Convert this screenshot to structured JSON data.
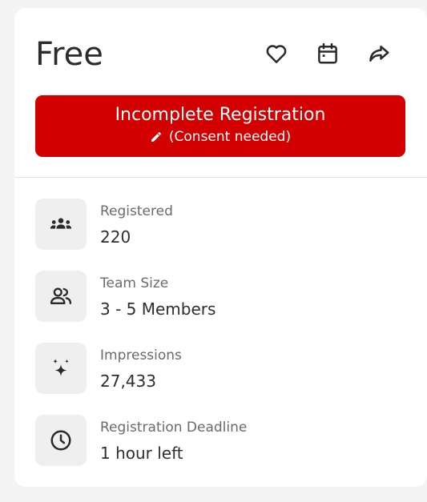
{
  "header": {
    "price": "Free",
    "icons": [
      "heart-icon",
      "calendar-icon",
      "share-icon"
    ]
  },
  "registration": {
    "title": "Incomplete Registration",
    "subtitle": "(Consent needed)",
    "icon": "pencil-icon",
    "color": "#d20000"
  },
  "stats": [
    {
      "icon": "people-group-icon",
      "label": "Registered",
      "value": "220"
    },
    {
      "icon": "team-icon",
      "label": "Team Size",
      "value": "3 - 5 Members"
    },
    {
      "icon": "sparkle-icon",
      "label": "Impressions",
      "value": "27,433"
    },
    {
      "icon": "clock-icon",
      "label": "Registration Deadline",
      "value": "1 hour left"
    }
  ]
}
